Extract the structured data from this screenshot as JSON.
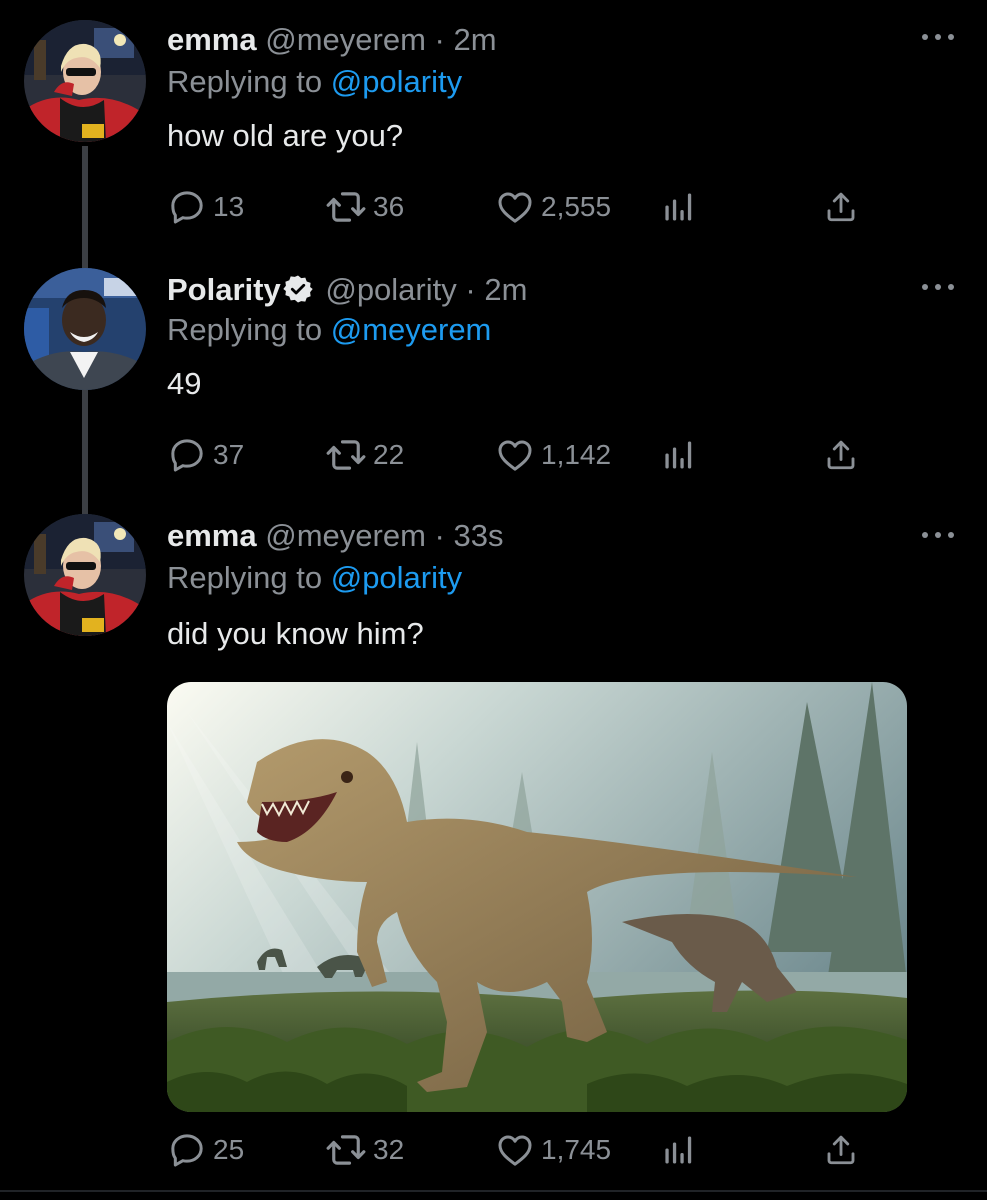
{
  "tweets": [
    {
      "name": "emma",
      "handle": "@meyerem",
      "separator": "·",
      "time": "2m",
      "replying_prefix": "Replying to",
      "replying_to": "@polarity",
      "text": "how old are you?",
      "replies": "13",
      "retweets": "36",
      "likes": "2,555",
      "verified": false
    },
    {
      "name": "Polarity",
      "handle": "@polarity",
      "separator": "·",
      "time": "2m",
      "replying_prefix": "Replying to",
      "replying_to": "@meyerem",
      "text": "49",
      "replies": "37",
      "retweets": "22",
      "likes": "1,142",
      "verified": true
    },
    {
      "name": "emma",
      "handle": "@meyerem",
      "separator": "·",
      "time": "33s",
      "replying_prefix": "Replying to",
      "replying_to": "@polarity",
      "text": "did you know him?",
      "replies": "25",
      "retweets": "32",
      "likes": "1,745",
      "verified": false,
      "media": "tyrannosaurus-photo"
    }
  ],
  "icons": {
    "reply": "reply-icon",
    "retweet": "retweet-icon",
    "like": "heart-icon",
    "analytics": "analytics-icon",
    "share": "share-icon",
    "more": "more-icon",
    "verified": "verified-badge-icon"
  },
  "colors": {
    "background": "#000000",
    "text": "#e7e9ea",
    "secondary": "#8b9096",
    "link": "#1d9bf0"
  }
}
